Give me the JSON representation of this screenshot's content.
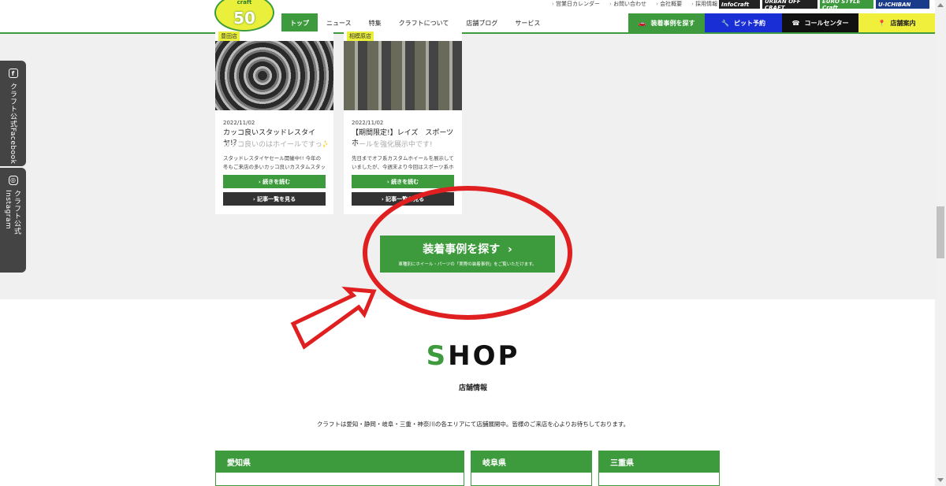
{
  "header": {
    "logo_number": "50",
    "logo_brand": "craft",
    "top_links": [
      "営業日カレンダー",
      "お問い合わせ",
      "会社概要",
      "採用情報"
    ],
    "partner_logos": [
      "InfoCraft",
      "URBAN OFF CRAFT",
      "EURO STYLE Craft",
      "U-ICHIBAN"
    ],
    "nav": [
      "トップ",
      "ニュース",
      "特集",
      "クラフトについて",
      "店舗ブログ",
      "サービス"
    ],
    "buttons": {
      "search_cases": "装着事例を探す",
      "pit_reserve": "ピット予約",
      "call_center": "コールセンター",
      "store_info": "店舗案内"
    }
  },
  "side": {
    "facebook": "クラフト公式Facebook",
    "instagram": "クラフト公式Instagram"
  },
  "cards": [
    {
      "shop": "豊田店",
      "date": "2022/11/02",
      "title": "カッコ良いスタッドレスタイヤ!？",
      "subtitle": "カッコ良いのはホイールですっ✨",
      "body": "スタッドレスタイヤセール開催中!! 今年の冬もご来店の多いカッコ良いカスタムスタッドレ",
      "read_more": "続きを読む",
      "list": "記事一覧を見る"
    },
    {
      "shop": "相模原店",
      "date": "2022/11/02",
      "title": "【期間限定!】レイズ　スポーツホ",
      "subtitle": "イールを強化展示中です!",
      "body": "先日までオフ系カスタムホイールを展示していましたが、今週末より今回はスポーツ系ホイ",
      "read_more": "続きを読む",
      "list": "記事一覧を見る"
    }
  ],
  "cta": {
    "title": "装着事例を探す",
    "arrow": "›",
    "subtitle": "車種別にホイール・パーツの「実際の装着事例」をご覧いただけます。"
  },
  "shop": {
    "title_first": "S",
    "title_rest": "HOP",
    "subtitle": "店舗情報",
    "description": "クラフトは愛知・静岡・岐阜・三重・神奈川の各エリアにて店舗展開中。皆様のご来店を心よりお待ちしております。",
    "regions": [
      "愛知県",
      "岐阜県",
      "三重県"
    ]
  },
  "colors": {
    "green": "#3d9b3d",
    "blue": "#1a2ed6",
    "black": "#111111",
    "yellow": "#f0f03c",
    "annotation_red": "#e02020"
  }
}
